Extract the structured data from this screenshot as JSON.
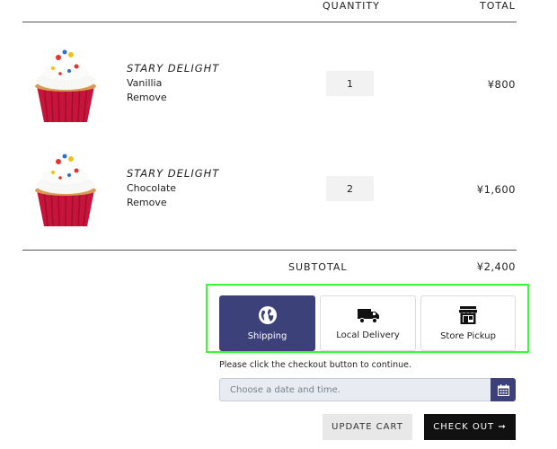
{
  "header": {
    "quantity_label": "QUANTITY",
    "total_label": "TOTAL"
  },
  "items": [
    {
      "brand": "STARY DELIGHT",
      "variant": "Vanillia",
      "remove_label": "Remove",
      "quantity": "1",
      "price": "¥800",
      "image": "cupcake-image"
    },
    {
      "brand": "STARY DELIGHT",
      "variant": "Chocolate",
      "remove_label": "Remove",
      "quantity": "2",
      "price": "¥1,600",
      "image": "cupcake-image"
    }
  ],
  "subtotal": {
    "label": "SUBTOTAL",
    "value": "¥2,400"
  },
  "delivery_options": [
    {
      "label": "Shipping",
      "icon": "globe-icon",
      "selected": true
    },
    {
      "label": "Local Delivery",
      "icon": "truck-icon",
      "selected": false
    },
    {
      "label": "Store Pickup",
      "icon": "store-icon",
      "selected": false
    }
  ],
  "checkout_note": "Please click the checkout button to continue.",
  "datetime": {
    "placeholder": "Choose a date and time.",
    "icon": "calendar-icon"
  },
  "buttons": {
    "update_cart": "UPDATE CART",
    "check_out": "CHECK OUT ➞"
  },
  "colors": {
    "accent": "#3d417a",
    "highlight_border": "#33ff33",
    "checkout_bg": "#111111"
  }
}
